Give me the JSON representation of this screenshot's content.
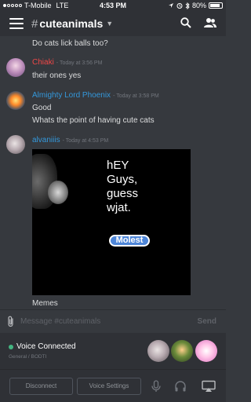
{
  "status_bar": {
    "carrier": "T-Mobile",
    "network": "LTE",
    "time": "4:53 PM",
    "battery": "80%"
  },
  "header": {
    "channel_name": "cuteanimals",
    "hash": "#",
    "menu_icon": "hamburger-icon",
    "search_icon": "search-icon",
    "members_icon": "members-icon"
  },
  "messages": [
    {
      "text": "Do cats lick balls too?"
    },
    {
      "username": "Chiaki",
      "username_color": "#f04747",
      "timestamp": "- Today at 3:56 PM",
      "lines": [
        "their ones yes"
      ]
    },
    {
      "username": "Almighty Lord Phoenix",
      "username_color": "#3498db",
      "timestamp": "- Today at 3:58 PM",
      "lines": [
        "Good",
        "Whats the point of having cute cats"
      ]
    },
    {
      "username": "alvaniiis",
      "username_color": "#3498db",
      "timestamp": "- Today at 4:53 PM",
      "image_text": "hEY\nGuys,\nguess\nwjat.",
      "image_button": "Molest",
      "caption": "Memes"
    }
  ],
  "input": {
    "placeholder": "Message #cuteanimals",
    "send_label": "Send"
  },
  "voice": {
    "title": "Voice Connected",
    "subtitle": "General / BODTI",
    "status_color": "#43b581"
  },
  "controls": {
    "disconnect_label": "Disconnect",
    "settings_label": "Voice Settings"
  },
  "colors": {
    "background": "#36393e",
    "panel": "#2f3136",
    "accent_blue": "#3498db"
  }
}
